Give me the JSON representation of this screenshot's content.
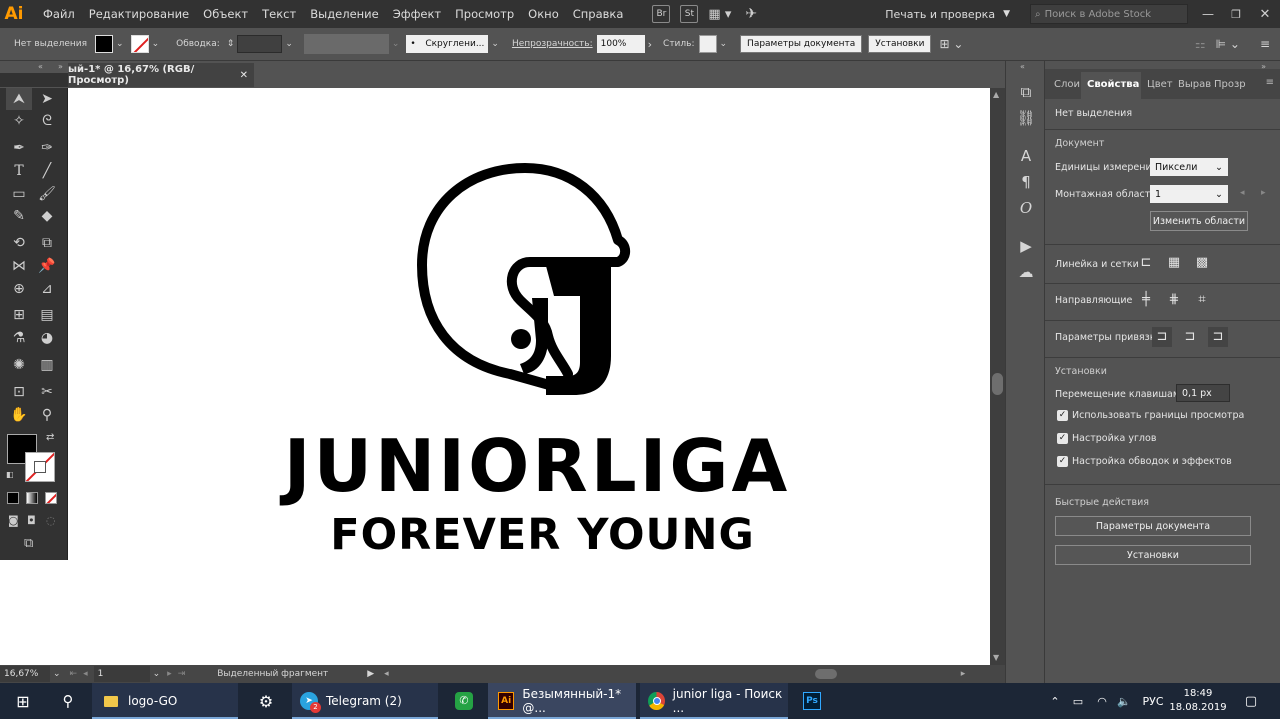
{
  "app": {
    "logo": "Ai",
    "menu": [
      "Файл",
      "Редактирование",
      "Объект",
      "Текст",
      "Выделение",
      "Эффект",
      "Просмотр",
      "Окно",
      "Справка"
    ],
    "bridge_btn": "Br",
    "stock_btn": "St",
    "workspace": "Печать и проверка",
    "search_placeholder": "Поиск в Adobe Stock"
  },
  "controlbar": {
    "selection_label": "Нет выделения",
    "stroke_label": "Обводка:",
    "round_label": "Скруглени...",
    "opacity_label": "Непрозрачность:",
    "opacity_value": "100%",
    "style_label": "Стиль:",
    "doc_setup_btn": "Параметры документа",
    "prefs_btn": "Установки"
  },
  "document": {
    "tab_title": "ый-1* @ 16,67% (RGB/Просмотр)",
    "zoom": "16,67%",
    "artboard_num": "1",
    "status": "Выделенный фрагмент"
  },
  "artwork": {
    "title_line1": "JUNIORLIGA",
    "title_line2": "FOREVER YOUNG",
    "helmet_letter": "J"
  },
  "panel": {
    "tabs": [
      "Слои",
      "Свойства",
      "Цвет",
      "Вырав",
      "Прозр"
    ],
    "active_tab": "Свойства",
    "no_selection": "Нет выделения",
    "doc_section": "Документ",
    "units_label": "Единицы измерения:",
    "units_value": "Пиксели",
    "artboard_label": "Монтажная область:",
    "artboard_value": "1",
    "edit_artboards_btn": "Изменить области",
    "rulers_label": "Линейка и сетки",
    "guides_label": "Направляющие",
    "snap_label": "Параметры привязки",
    "prefs_section": "Установки",
    "keyboard_label": "Перемещение клавишами:",
    "keyboard_value": "0,1 px",
    "check1": "Использовать границы просмотра",
    "check2": "Настройка углов",
    "check3": "Настройка обводок и эффектов",
    "quick_section": "Быстрые действия",
    "quick_btn1": "Параметры документа",
    "quick_btn2": "Установки"
  },
  "taskbar": {
    "explorer_label": "logo-GO",
    "telegram_label": "Telegram (2)",
    "telegram_badge": "2",
    "illustrator_label": "Безымянный-1* @...",
    "chrome_label": "junior liga - Поиск ...",
    "ps_label": "Ps",
    "lang": "РУС",
    "time": "18:49",
    "date": "18.08.2019"
  }
}
